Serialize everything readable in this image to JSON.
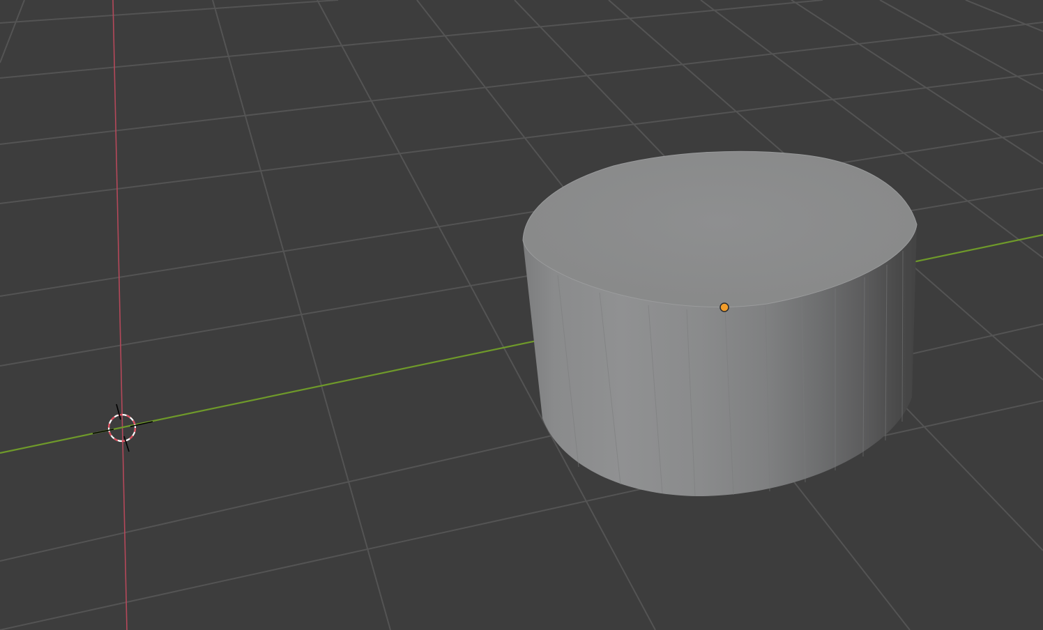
{
  "app": "3D Viewport",
  "colors": {
    "background": "#3d3d3d",
    "grid": "#545454",
    "x_axis": "#b5485a",
    "y_axis": "#6f9a2a",
    "cylinder_top": "#8b8c8e",
    "cylinder_side_light": "#8f9091",
    "cylinder_side_dark": "#474747",
    "object_origin": "#f29d2a"
  },
  "scene": {
    "object": {
      "type": "cylinder",
      "selected": false,
      "origin_marker": "object-origin-dot"
    },
    "cursor": {
      "icon": "3d-cursor-icon"
    },
    "axes": [
      "x-axis",
      "y-axis"
    ],
    "floor_grid": true
  }
}
